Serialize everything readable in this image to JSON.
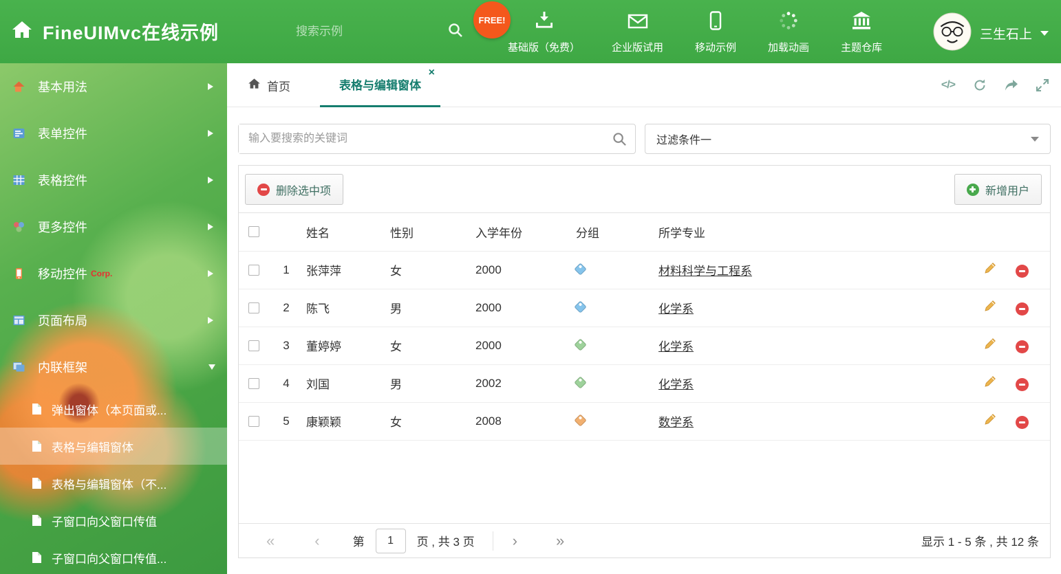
{
  "header": {
    "app_title": "FineUIMvc在线示例",
    "search_placeholder": "搜索示例",
    "free_badge": "FREE!",
    "nav": [
      {
        "label": "基础版（免费）"
      },
      {
        "label": "企业版试用"
      },
      {
        "label": "移动示例"
      },
      {
        "label": "加载动画"
      },
      {
        "label": "主题仓库"
      }
    ],
    "username": "三生石上"
  },
  "sidebar": {
    "items": [
      {
        "label": "基本用法"
      },
      {
        "label": "表单控件"
      },
      {
        "label": "表格控件"
      },
      {
        "label": "更多控件"
      },
      {
        "label": "移动控件",
        "badge": "Corp."
      },
      {
        "label": "页面布局"
      },
      {
        "label": "内联框架"
      }
    ],
    "subitems": [
      {
        "label": "弹出窗体（本页面或..."
      },
      {
        "label": "表格与编辑窗体"
      },
      {
        "label": "表格与编辑窗体（不..."
      },
      {
        "label": "子窗口向父窗口传值"
      },
      {
        "label": "子窗口向父窗口传值..."
      }
    ]
  },
  "tabs": {
    "home": "首页",
    "active": "表格与编辑窗体",
    "close_icon": "×"
  },
  "tab_tools": {
    "code_icon": "</>"
  },
  "filters": {
    "search_placeholder": "输入要搜索的关键词",
    "filter_value": "过滤条件一"
  },
  "grid": {
    "delete_selected_label": "删除选中项",
    "add_user_label": "新增用户",
    "columns": {
      "name": "姓名",
      "gender": "性别",
      "year": "入学年份",
      "group": "分组",
      "major": "所学专业"
    },
    "rows": [
      {
        "index": "1",
        "name": "张萍萍",
        "gender": "女",
        "year": "2000",
        "tag_color": "#85c4ec",
        "major": "材料科学与工程系"
      },
      {
        "index": "2",
        "name": "陈飞",
        "gender": "男",
        "year": "2000",
        "tag_color": "#85c4ec",
        "major": "化学系"
      },
      {
        "index": "3",
        "name": "董婷婷",
        "gender": "女",
        "year": "2000",
        "tag_color": "#9ed29b",
        "major": "化学系"
      },
      {
        "index": "4",
        "name": "刘国",
        "gender": "男",
        "year": "2002",
        "tag_color": "#9ed29b",
        "major": "化学系"
      },
      {
        "index": "5",
        "name": "康颖颖",
        "gender": "女",
        "year": "2008",
        "tag_color": "#f2b070",
        "major": "数学系"
      }
    ]
  },
  "pagination": {
    "first_icon": "«",
    "prev_icon": "‹",
    "next_icon": "›",
    "last_icon": "»",
    "page_prefix": "第",
    "current_page": "1",
    "page_suffix": "页 , 共 3 页",
    "summary": "显示 1 - 5 条 , 共 12 条"
  },
  "colors": {
    "header_green": "#3ea844",
    "accent_teal": "#157d6e",
    "badge_orange": "#f4581c",
    "delete_red": "#e24848",
    "add_green": "#49a94d"
  }
}
